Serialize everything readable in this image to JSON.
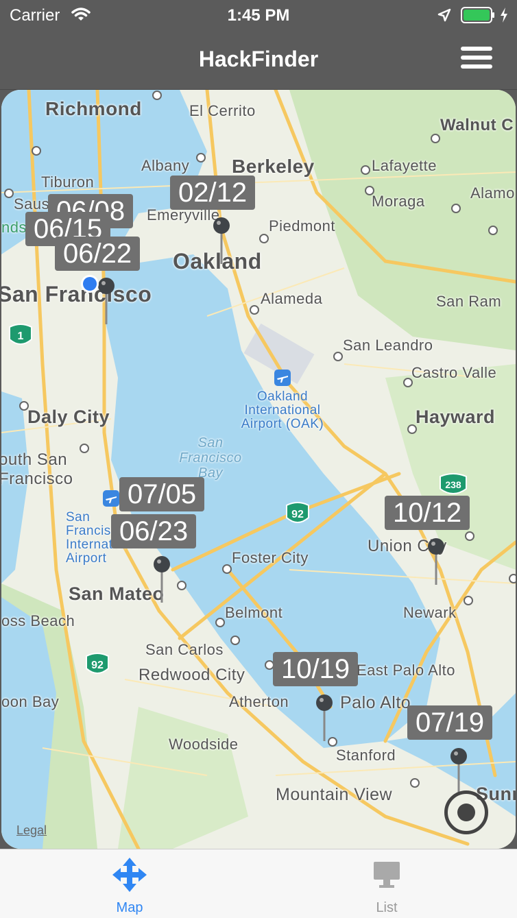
{
  "status": {
    "carrier": "Carrier",
    "time": "1:45 PM"
  },
  "nav": {
    "title": "HackFinder"
  },
  "map": {
    "places": {
      "richmond": "Richmond",
      "el_cerrito": "El Cerrito",
      "walnut": "Walnut C",
      "albany": "Albany",
      "berkeley": "Berkeley",
      "lafayette": "Lafayette",
      "tiburon": "Tiburon",
      "sausalito": "Saus",
      "emeryville": "Emeryville",
      "moraga": "Moraga",
      "alamo": "Alamo",
      "piedmont": "Piedmont",
      "oakland": "Oakland",
      "san_francisco": "San Francisco",
      "alameda": "Alameda",
      "san_ramon": "San Ram",
      "san_leandro": "San Leandro",
      "castro_valley": "Castro Valle",
      "oakland_airport": "Oakland International Airport (OAK)",
      "daly_city": "Daly City",
      "hayward": "Hayward",
      "sf_bay": "San Francisco Bay",
      "south_sf": "outh San Francisco",
      "sfo": "San Francisco International Airport",
      "union_city": "Union City",
      "foster_city": "Foster City",
      "san_mateo": "San Mateo",
      "newark": "Newark",
      "belmont": "Belmont",
      "moss_beach": "oss Beach",
      "san_carlos": "San Carlos",
      "redwood_city": "Redwood City",
      "east_palo_alto": "East Palo Alto",
      "half_moon_bay": "oon Bay",
      "atherton": "Atherton",
      "palo_alto": "Palo Alto",
      "woodside": "Woodside",
      "stanford": "Stanford",
      "mountain_view": "Mountain View",
      "sunnyvale": "Sunn",
      "lands": "nds"
    },
    "highways": {
      "h1": "1",
      "h92a": "92",
      "h92b": "92",
      "h238": "238"
    },
    "events": [
      "06/08",
      "06/15",
      "06/22",
      "02/12",
      "07/05",
      "06/23",
      "10/12",
      "10/19",
      "07/19"
    ],
    "legal": "Legal",
    "colors": {
      "water": "#a8d7f0",
      "land": "#eef0e6",
      "park": "#cfe6bd",
      "road": "#f6c860"
    }
  },
  "tabs": {
    "map": "Map",
    "list": "List"
  },
  "colors": {
    "bar": "#5b5b5b",
    "accent": "#2f86f3",
    "callout": "#707070"
  }
}
